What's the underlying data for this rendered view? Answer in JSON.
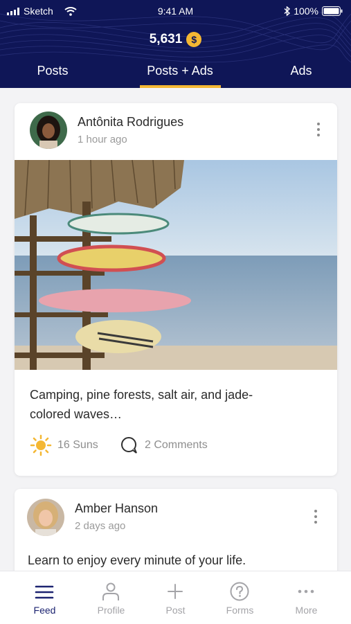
{
  "status_bar": {
    "carrier": "Sketch",
    "time": "9:41 AM",
    "battery": "100%"
  },
  "header": {
    "coin_balance": "5,631",
    "coin_symbol": "$",
    "tabs": [
      {
        "label": "Posts",
        "active": false
      },
      {
        "label": "Posts + Ads",
        "active": true
      },
      {
        "label": "Ads",
        "active": false
      }
    ],
    "background_color": "#0f1657",
    "accent_color": "#f4b733"
  },
  "posts": [
    {
      "author": "Antônita Rodrigues",
      "time": "1 hour ago",
      "caption_line1": "Camping, pine forests, salt air, and jade-",
      "caption_line2": "colored waves…",
      "suns": "16 Suns",
      "comments": "2 Comments"
    },
    {
      "author": "Amber Hanson",
      "time": "2 days ago",
      "caption_line1": "Learn to enjoy every minute of your life."
    }
  ],
  "bottom_nav": [
    {
      "label": "Feed",
      "icon": "menu-icon",
      "active": true
    },
    {
      "label": "Profile",
      "icon": "person-icon",
      "active": false
    },
    {
      "label": "Post",
      "icon": "plus-icon",
      "active": false
    },
    {
      "label": "Forms",
      "icon": "question-icon",
      "active": false
    },
    {
      "label": "More",
      "icon": "more-icon",
      "active": false
    }
  ]
}
